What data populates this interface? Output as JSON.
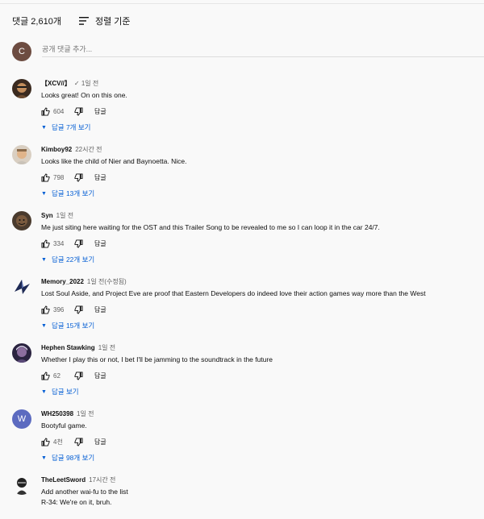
{
  "header": {
    "comment_count": "댓글 2,610개",
    "sort_label": "정렬 기준"
  },
  "compose": {
    "avatar_letter": "C",
    "placeholder": "공개 댓글 추가..."
  },
  "comments": [
    {
      "author": "【XCV//】",
      "time": "✓ 1일 전",
      "text": "Looks great!  On on this one.",
      "likes": "604",
      "reply_label": "답글",
      "replies_label": "답글 7개 보기"
    },
    {
      "author": "Kimboy92",
      "time": "22시간 전",
      "text": "Looks like the child of Nier and Baynoetta. Nice.",
      "likes": "798",
      "reply_label": "답글",
      "replies_label": "답글 13개 보기"
    },
    {
      "author": "Syn",
      "time": "1일 전",
      "text": "Me just siting here waiting for the OST and this Trailer Song to be revealed to me so I can loop it in the car 24/7.",
      "likes": "334",
      "reply_label": "답글",
      "replies_label": "답글 22개 보기"
    },
    {
      "author": "Memory_2022",
      "time": "1일 전(수정됨)",
      "text": "Lost Soul Aside, and Project Eve are proof that Eastern Developers do indeed love their action games way more than the West",
      "likes": "396",
      "reply_label": "답글",
      "replies_label": "답글 15개 보기"
    },
    {
      "author": "Hephen Stawking",
      "time": "1일 전",
      "text": "Whether I play this or not, I bet I'll be jamming to the soundtrack in the future",
      "likes": "62",
      "reply_label": "답글",
      "replies_label": "답글 보기"
    },
    {
      "author": "WH250398",
      "time": "1일 전",
      "text": "Bootyful game.",
      "likes": "4천",
      "reply_label": "답글",
      "replies_label": "답글 98개 보기",
      "avatar_letter": "W"
    },
    {
      "author": "TheLeetSword",
      "time": "17시간 전",
      "text": "Add another wai-fu to the list",
      "text2": "R-34: We're on it, bruh."
    }
  ],
  "colors": {
    "background": "#f9f9f9",
    "link_blue": "#065fd4",
    "secondary_text": "#606060",
    "w_avatar": "#5c6bc0",
    "me_avatar": "#6d4c41"
  }
}
